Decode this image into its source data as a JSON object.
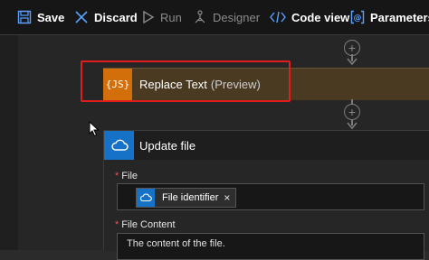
{
  "toolbar": {
    "save_label": "Save",
    "discard_label": "Discard",
    "run_label": "Run",
    "designer_label": "Designer",
    "codeview_label": "Code view",
    "parameters_label": "Parameters"
  },
  "replace_action": {
    "icon_text": "{JS}",
    "title": "Replace Text",
    "hint": "(Preview)"
  },
  "update_action": {
    "title": "Update file",
    "file_label": "File",
    "file_token": "File identifier",
    "token_remove": "×",
    "content_label": "File Content",
    "content_value": "The content of the file.",
    "required_marker": "*"
  },
  "colors": {
    "toolbar_bg": "#161616",
    "js_accent": "#d36f0a",
    "onedrive_accent": "#1572c7",
    "highlight": "#e21d1d",
    "required": "#e55353"
  },
  "icons": [
    "save-icon",
    "discard-icon",
    "run-icon",
    "designer-icon",
    "code-view-icon",
    "parameters-icon",
    "onedrive-cloud-icon",
    "add-step-icon",
    "arrow-down-icon",
    "mouse-cursor-icon"
  ]
}
